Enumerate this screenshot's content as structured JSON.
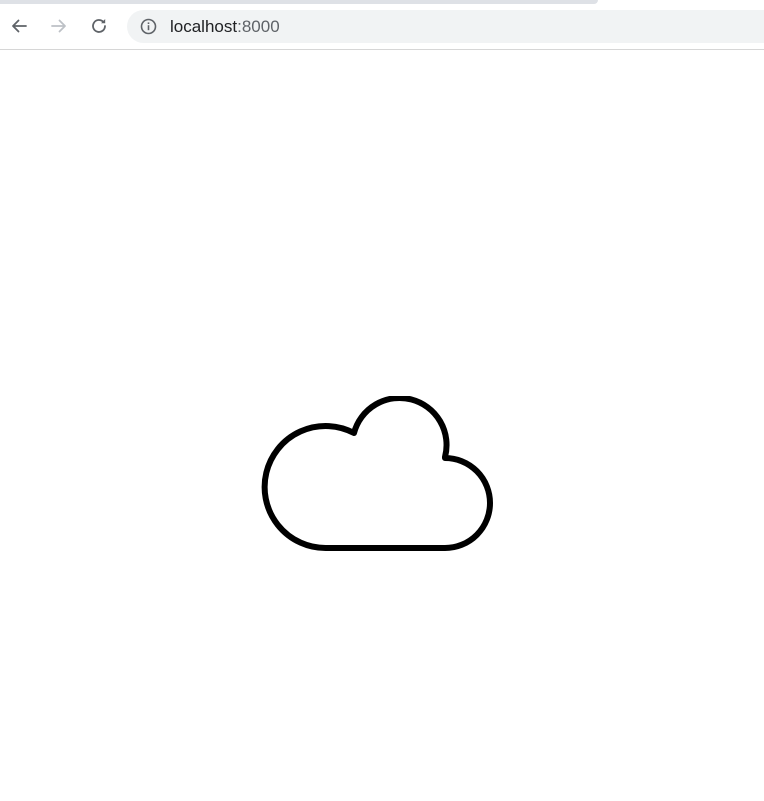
{
  "browser": {
    "address_bar": {
      "host": "localhost",
      "port": ":8000"
    },
    "buttons": {
      "back": "arrow-left-icon",
      "forward": "arrow-right-icon",
      "reload": "reload-icon"
    }
  },
  "page": {
    "icon": "cloud-icon"
  },
  "colors": {
    "omnibox_bg": "#f1f3f4",
    "icon_stroke": "#000000",
    "nav_active": "#5f6368",
    "nav_disabled": "#bdc1c6"
  }
}
